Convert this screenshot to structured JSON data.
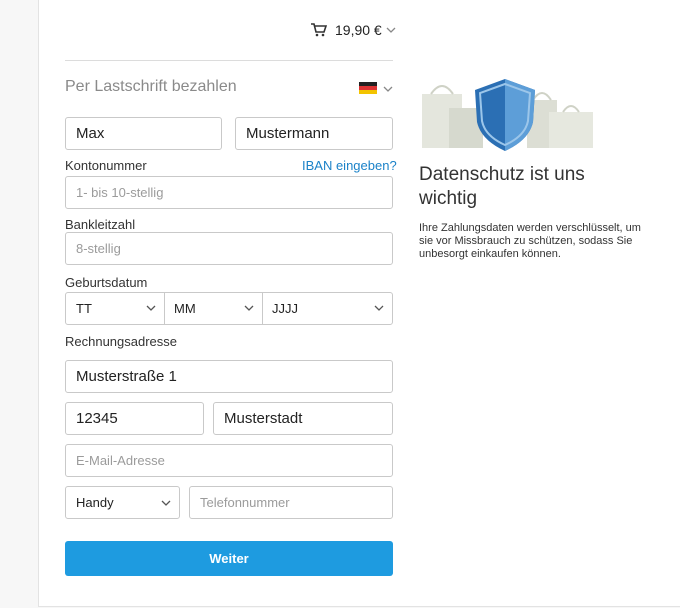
{
  "cart": {
    "price": "19,90 €"
  },
  "payment": {
    "title": "Per Lastschrift bezahlen",
    "iban_link": "IBAN eingeben?"
  },
  "name": {
    "first_value": "Max",
    "last_value": "Mustermann"
  },
  "konto": {
    "label": "Kontonummer",
    "placeholder": "1- bis 10-stellig"
  },
  "blz": {
    "label": "Bankleitzahl",
    "placeholder": "8-stellig"
  },
  "dob": {
    "label": "Geburtsdatum",
    "day": "TT",
    "month": "MM",
    "year": "JJJJ"
  },
  "address": {
    "label": "Rechnungsadresse",
    "street": "Musterstraße 1",
    "zip": "12345",
    "city": "Musterstadt",
    "email_placeholder": "E-Mail-Adresse",
    "phone_type": "Handy",
    "phone_placeholder": "Telefonnummer"
  },
  "submit": {
    "label": "Weiter"
  },
  "privacy": {
    "title": "Datenschutz ist uns wichtig",
    "text": "Ihre Zahlungsdaten werden verschlüsselt, um sie vor Missbrauch zu schützen, sodass Sie unbesorgt einkaufen können."
  },
  "colors": {
    "accent": "#1e9be0",
    "link": "#1b82c8",
    "shield": "#2b6fb4"
  },
  "icons": [
    "cart-icon",
    "chevron-down-icon",
    "german-flag-icon",
    "shield-icon"
  ]
}
